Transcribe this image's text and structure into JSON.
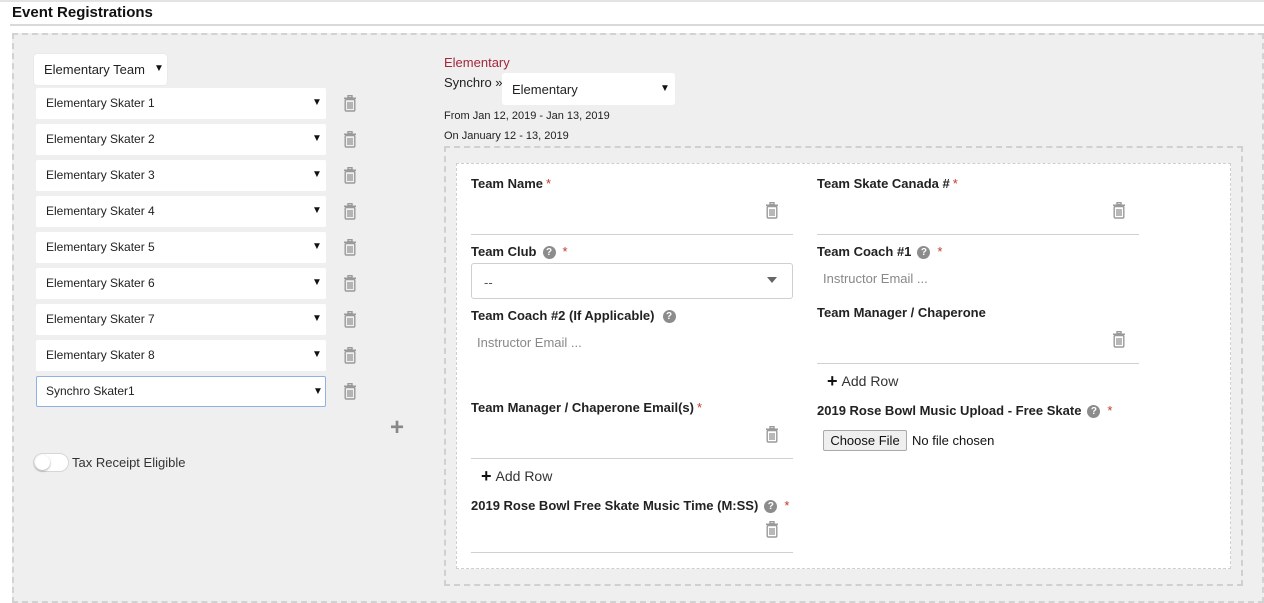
{
  "page": {
    "title": "Event Registrations"
  },
  "left": {
    "team_select": "Elementary Team",
    "skaters": [
      "Elementary Skater 1",
      "Elementary Skater 2",
      "Elementary Skater 3",
      "Elementary Skater 4",
      "Elementary Skater 5",
      "Elementary Skater 6",
      "Elementary Skater 7",
      "Elementary Skater 8",
      "Synchro Skater1"
    ],
    "tax_receipt_label": "Tax Receipt Eligible",
    "tax_receipt_on": false
  },
  "event": {
    "category": "Elementary",
    "crumb": "Synchro »",
    "level_select": "Elementary",
    "dates": "From Jan 12, 2019 - Jan 13, 2019",
    "on": "On January 12 - 13, 2019"
  },
  "form": {
    "required_mark": "*",
    "help_glyph": "?",
    "team_name": "Team Name",
    "team_skate_canada": "Team Skate Canada #",
    "team_club": "Team Club",
    "team_club_value": "--",
    "team_coach1": "Team Coach #1",
    "team_coach1_placeholder": "Instructor Email ...",
    "team_coach2": "Team Coach #2 (If Applicable)",
    "team_coach2_placeholder": "Instructor Email ...",
    "team_manager": "Team Manager / Chaperone",
    "add_row": "Add Row",
    "manager_emails": "Team Manager / Chaperone Email(s)",
    "music_upload": "2019 Rose Bowl Music Upload - Free Skate",
    "choose_file": "Choose File",
    "no_file": "No file chosen",
    "music_time": "2019 Rose Bowl Free Skate Music Time (M:SS)"
  },
  "colors": {
    "accent": "#a3273b",
    "required": "#c0392b",
    "panel": "#efefef"
  },
  "icons": {
    "delete": "trash-icon",
    "add": "plus-icon",
    "help": "question-icon",
    "dropdown": "caret-down-icon"
  }
}
